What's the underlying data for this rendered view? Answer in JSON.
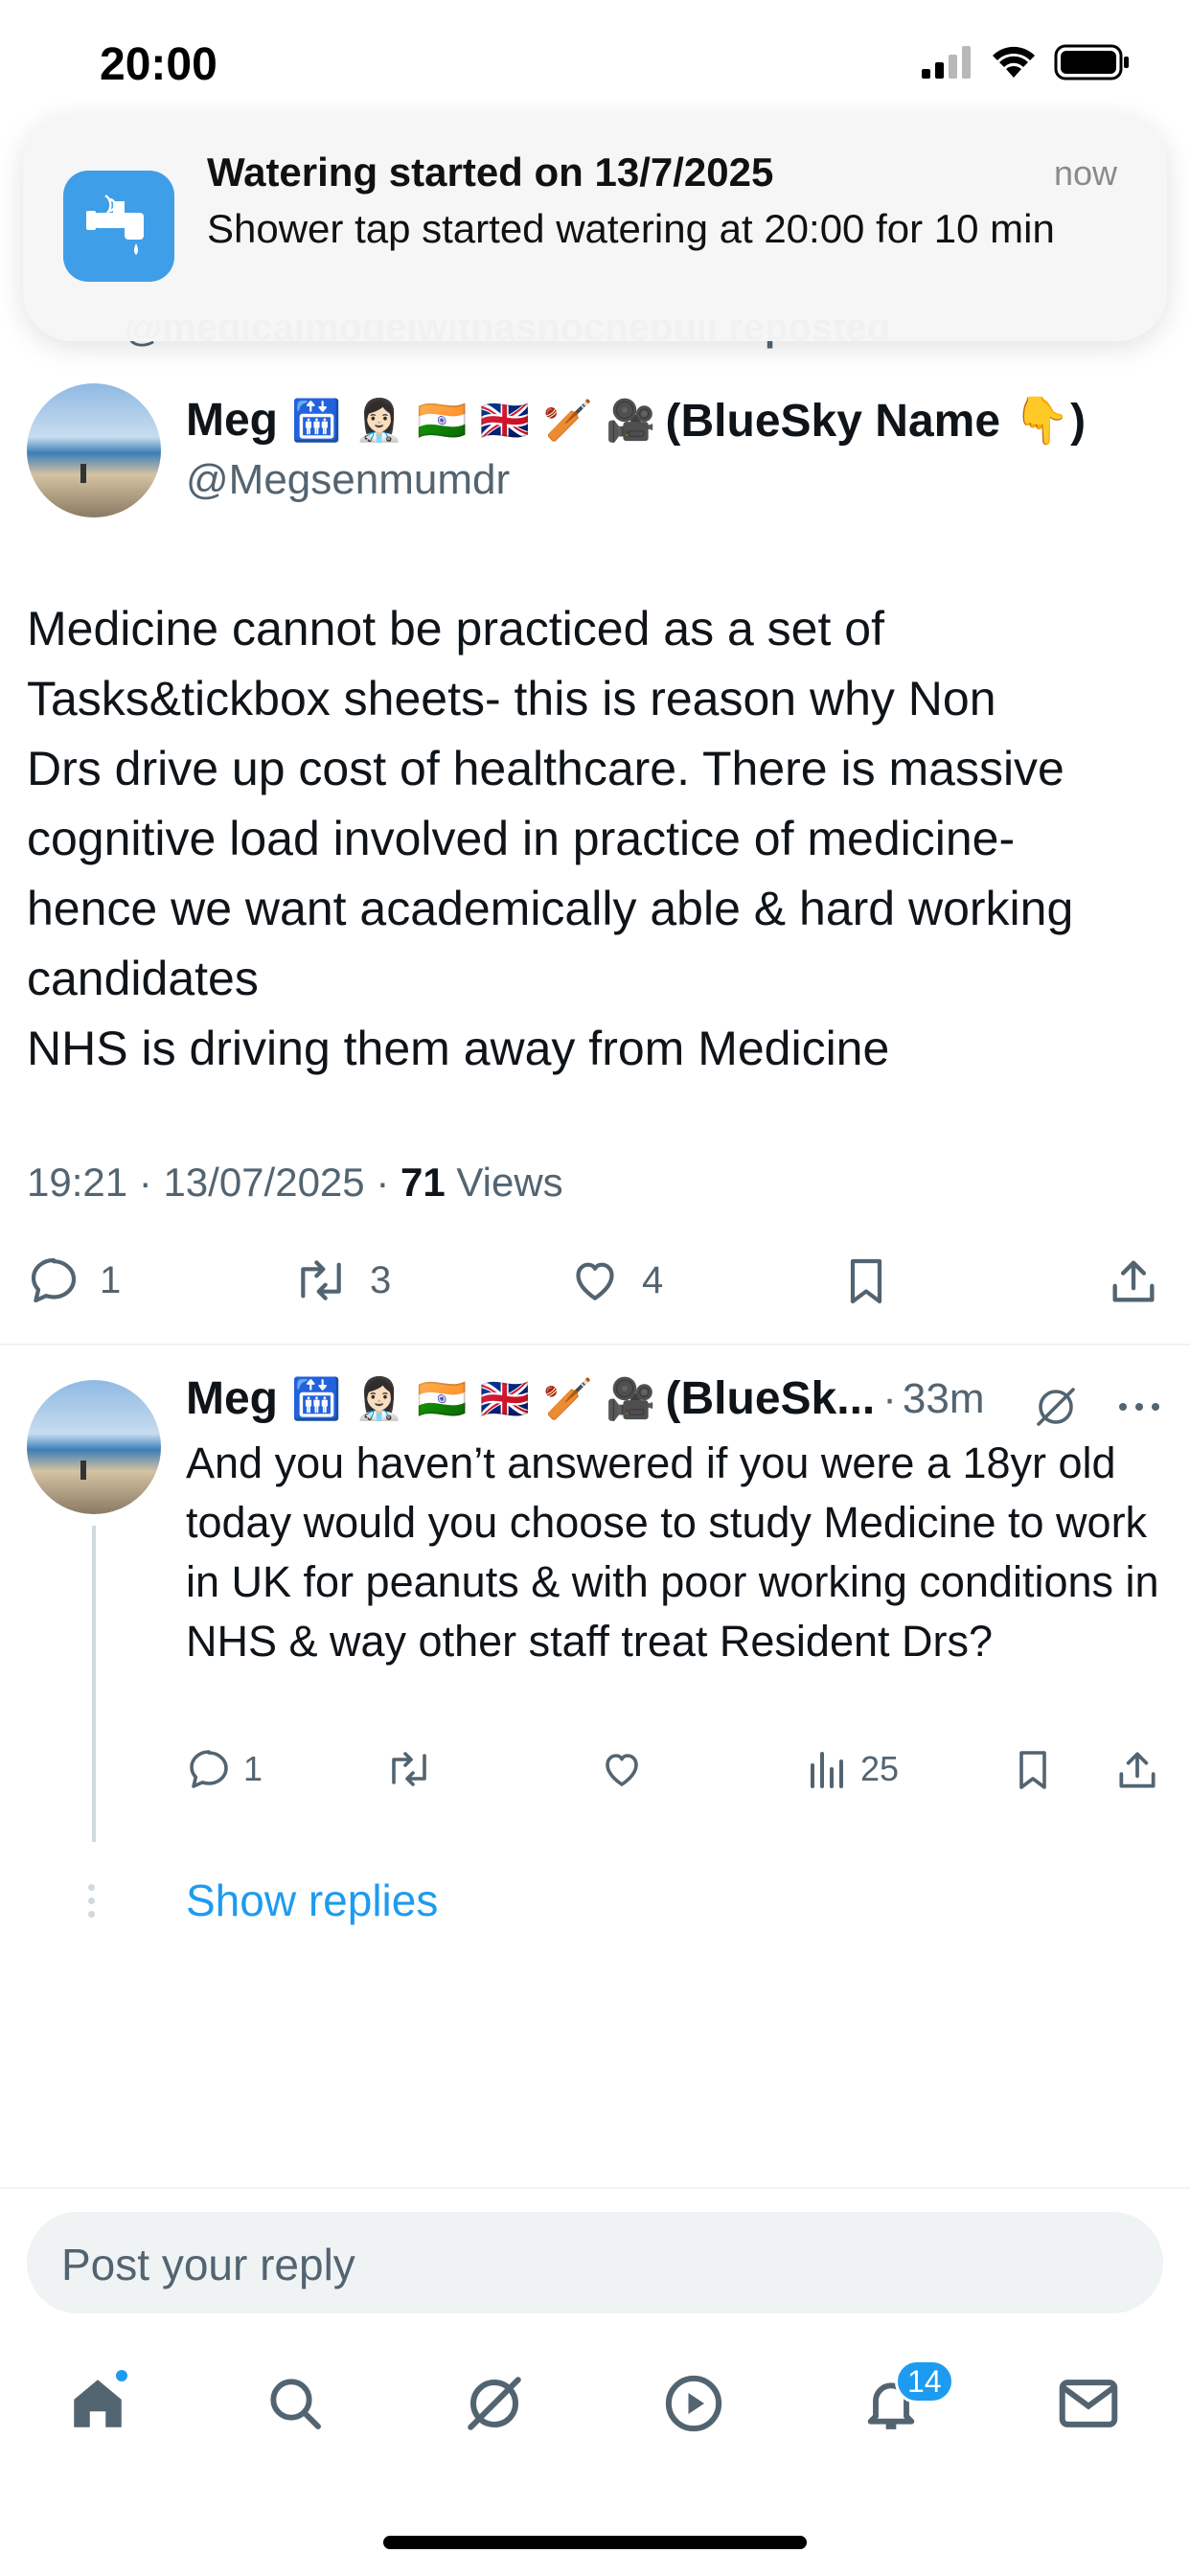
{
  "status_bar": {
    "time": "20:00"
  },
  "notification": {
    "title": "Watering started on 13/7/2025",
    "body": "Shower tap started watering at 20:00 for 10 min",
    "time": "now",
    "app_icon": "tap-icon",
    "accent": "#3f9ee8"
  },
  "repost_peek": "@medicalmodelwithasnochebull reposted",
  "post": {
    "author_name": "Meg",
    "author_emojis": "🛗 👩🏻‍⚕️ 🇮🇳 🇬🇧 🏏 🎥",
    "author_suffix": "(BlueSky Name 👇)",
    "handle": "@Megsenmumdr",
    "text": "Medicine cannot be practiced as a set of\nTasks&tickbox sheets- this is reason why Non\nDrs drive up cost of healthcare. There is massive\ncognitive load involved in practice of medicine-\nhence we want academically able & hard working\ncandidates\nNHS is driving them away from Medicine",
    "time": "19:21",
    "date": "13/07/2025",
    "views_count": "71",
    "views_label": "Views",
    "replies": "1",
    "reposts": "3",
    "likes": "4"
  },
  "reply": {
    "author_name": "Meg",
    "author_emojis": "🛗 👩🏻‍⚕️ 🇮🇳 🇬🇧 🏏 🎥",
    "author_suffix": "(BlueSk...",
    "time_ago": "33m",
    "text": "And you haven’t answered if you were a 18yr old today would you choose to study Medicine to work in UK for peanuts & with poor working conditions in NHS & way other staff treat Resident Drs?",
    "replies": "1",
    "views": "25"
  },
  "show_replies": "Show replies",
  "composer": {
    "placeholder": "Post your reply"
  },
  "tabbar": {
    "notifications_badge": "14"
  },
  "colors": {
    "link": "#1d9bf0",
    "secondary_text": "#536471",
    "divider": "#eff3f4"
  }
}
